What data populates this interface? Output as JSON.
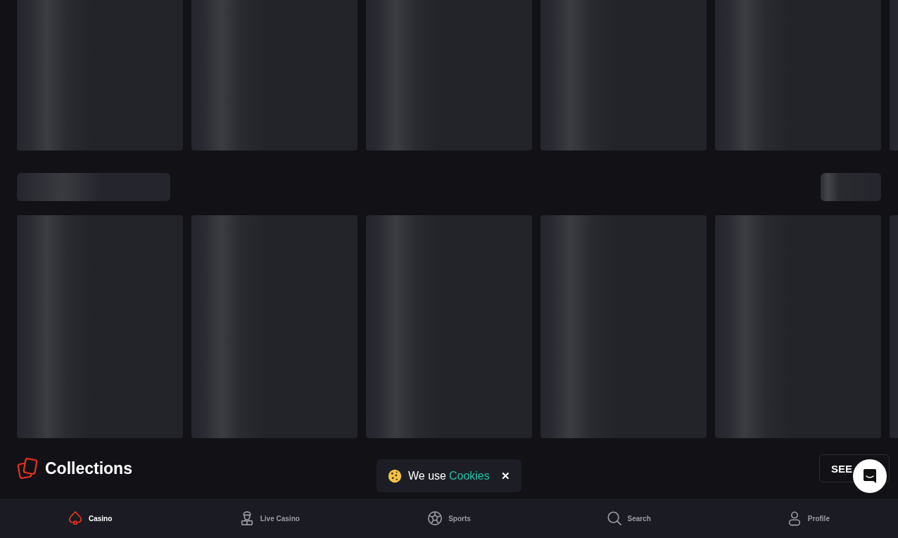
{
  "collections": {
    "title": "Collections",
    "see_all_button": "SEE"
  },
  "cookie_banner": {
    "text": "We use",
    "link": "Cookies",
    "close": "✕"
  },
  "bottom_nav": [
    {
      "label": "Casino",
      "selected": true
    },
    {
      "label": "Live Casino",
      "selected": false
    },
    {
      "label": "Sports",
      "selected": false
    },
    {
      "label": "Search",
      "selected": false
    },
    {
      "label": "Profile",
      "selected": false
    }
  ]
}
